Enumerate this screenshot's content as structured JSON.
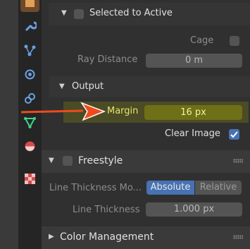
{
  "panel": {
    "selected_to_active": {
      "label": "Selected to Active"
    },
    "cage_label": "Cage",
    "ray_distance": {
      "label": "Ray Distance",
      "value": "0 m"
    },
    "output": {
      "label": "Output"
    },
    "margin": {
      "label": "Margin",
      "value": "16 px"
    },
    "clear_image_label": "Clear Image",
    "freestyle": {
      "label": "Freestyle"
    },
    "line_thickness_mode": {
      "label": "Line Thickness Mo...",
      "options": [
        "Absolute",
        "Relative"
      ],
      "selected": "Absolute"
    },
    "line_thickness": {
      "label": "Line Thickness",
      "value": "1.000 px"
    },
    "color_management": {
      "label": "Color Management"
    }
  },
  "colors": {
    "accent": "#4772b3",
    "highlight": "#e5e56a",
    "annotation_arrow": "#ee4b1c"
  },
  "tabs": [
    "render-icon",
    "tool-wrench-icon",
    "particles-icon",
    "physics-icon",
    "constraints-icon",
    "object-data-icon",
    "material-icon",
    "texture-icon"
  ]
}
